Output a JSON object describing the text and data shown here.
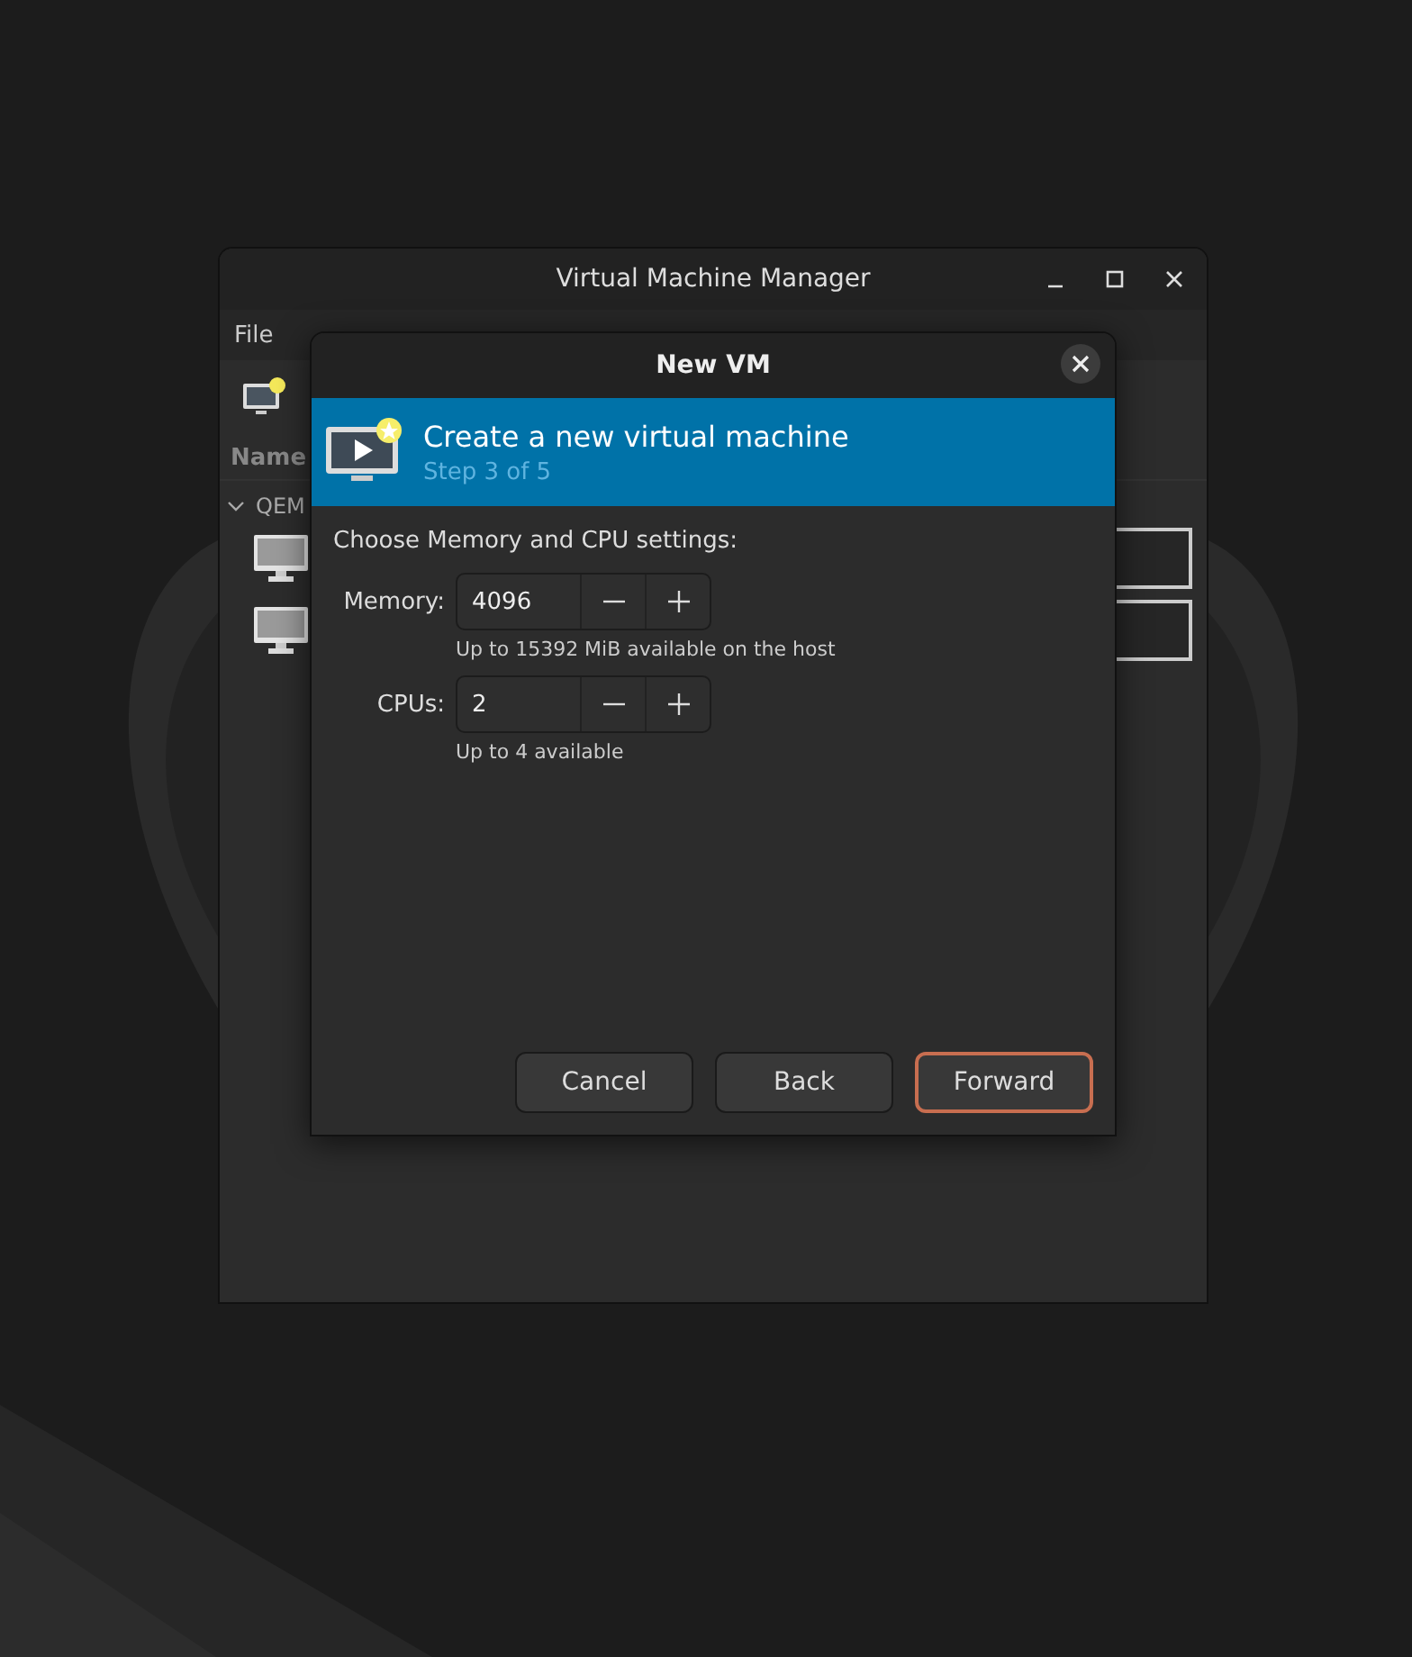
{
  "main_window": {
    "title": "Virtual Machine Manager",
    "menu": [
      "File"
    ],
    "column": "Name",
    "group": {
      "label": "QEM",
      "expanded": true,
      "vms": [
        {
          "kind": "vm"
        },
        {
          "kind": "vm"
        }
      ]
    }
  },
  "dialog": {
    "title": "New VM",
    "heading": "Create a new virtual machine",
    "step": "Step 3 of 5",
    "prompt": "Choose Memory and CPU settings:",
    "fields": [
      {
        "label": "Memory:",
        "value": "4096",
        "hint": "Up to 15392 MiB available on the host"
      },
      {
        "label": "CPUs:",
        "value": "2",
        "hint": "Up to 4 available"
      }
    ],
    "buttons": [
      {
        "label": "Cancel",
        "default": false
      },
      {
        "label": "Back",
        "default": false
      },
      {
        "label": "Forward",
        "default": true
      }
    ]
  }
}
